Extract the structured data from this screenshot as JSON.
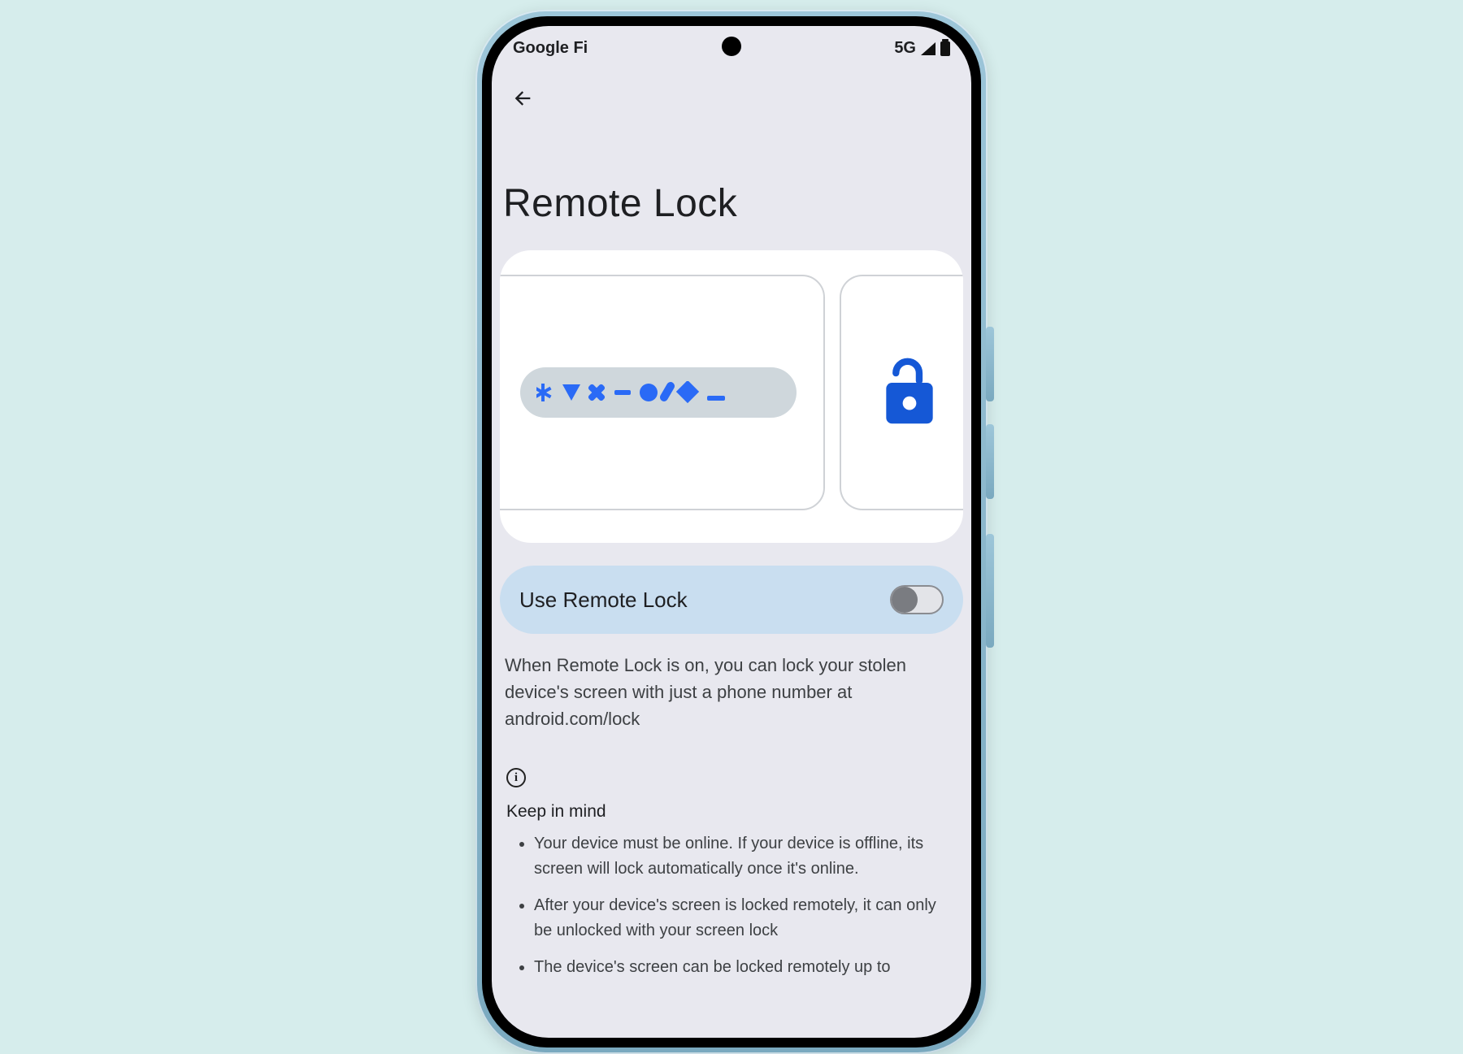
{
  "status_bar": {
    "carrier": "Google Fi",
    "network": "5G"
  },
  "icons": {
    "back": "arrow-back",
    "signal": "cellular-signal",
    "battery": "battery-full",
    "info": "info",
    "unlock": "lock-open"
  },
  "page": {
    "title": "Remote Lock",
    "toggle_label": "Use Remote Lock",
    "toggle_on": false,
    "description": "When Remote Lock is on, you can lock your stolen device's screen with just a phone number at android.com/lock",
    "info_title": "Keep in mind",
    "info_items": [
      "Your device must be online. If your device is offline, its screen will lock automatically once it's online.",
      "After your device's screen is locked remotely, it can only be unlocked with your screen lock",
      "The device's screen can be locked remotely up to"
    ]
  },
  "colors": {
    "page_bg": "#d6edec",
    "screen_bg": "#e8e8ef",
    "accent_panel": "#c9def0",
    "primary_blue": "#1558d6"
  }
}
